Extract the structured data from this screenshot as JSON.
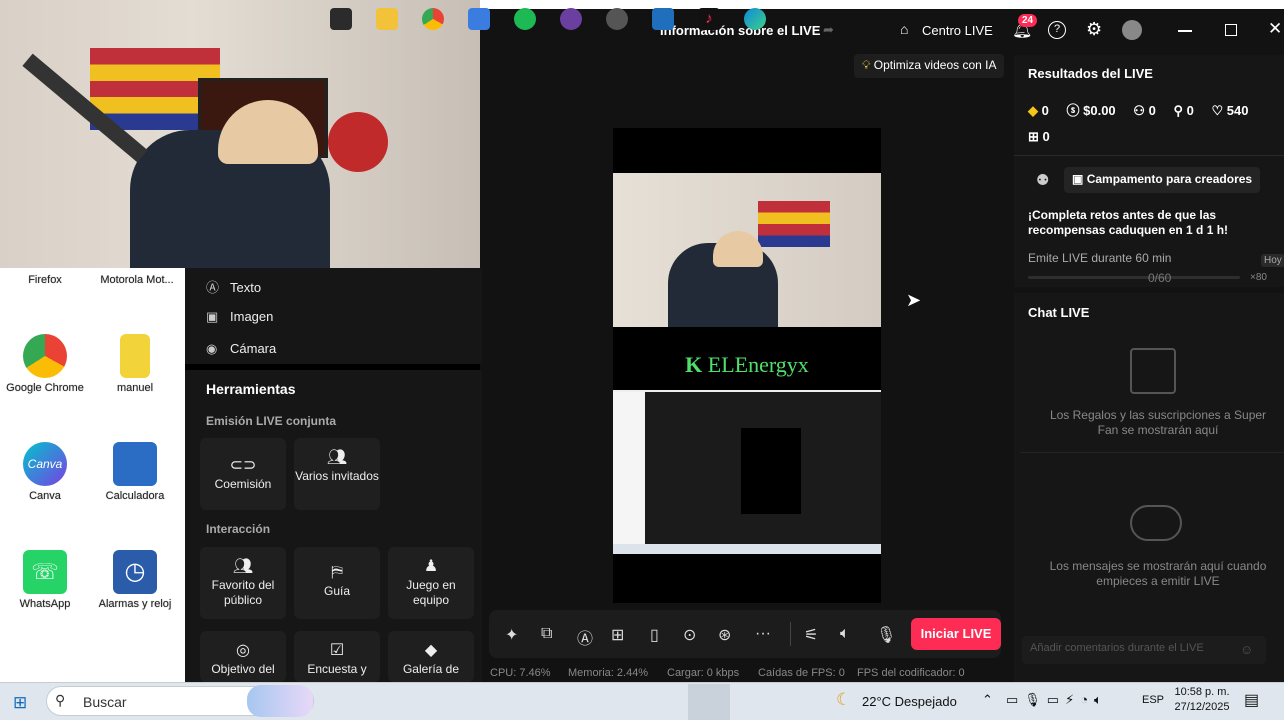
{
  "desktop": {
    "top_labels": [
      "Firefox",
      "Motorola Mot..."
    ],
    "icons": [
      {
        "label": "Google Chrome",
        "icon": "chrome-icon",
        "color": "#4285f4"
      },
      {
        "label": "manuel",
        "icon": "file-icon",
        "color": "#e0c020"
      },
      {
        "label": "Canva",
        "icon": "canva-icon",
        "color": "#7b3fe4"
      },
      {
        "label": "Calculadora",
        "icon": "calculator-icon",
        "color": "#2b6cc4"
      },
      {
        "label": "WhatsApp",
        "icon": "whatsapp-icon",
        "color": "#25d366"
      },
      {
        "label": "Alarmas y reloj",
        "icon": "clock-icon",
        "color": "#2a5caa"
      }
    ]
  },
  "header": {
    "live_info": "Información sobre el LIVE",
    "centro_live": "Centro LIVE",
    "notif_count": "24",
    "optimize": "Optimiza videos con IA"
  },
  "left_panel": {
    "media_items": [
      "Texto",
      "Imagen",
      "Cámara"
    ],
    "tools_title": "Herramientas",
    "joint_title": "Emisión LIVE conjunta",
    "joint_tools": [
      "Coemisión",
      "Varios invitados"
    ],
    "interaction_title": "Interacción",
    "interaction_tools": [
      "Favorito del público",
      "Guía",
      "Juego en equipo"
    ],
    "more_tools": [
      "Objetivo del",
      "Encuesta y",
      "Galería de"
    ]
  },
  "preview": {
    "brand": "ELEnergyx"
  },
  "controls": {
    "start_button": "Iniciar LIVE",
    "accent": "#fe2c55"
  },
  "status": {
    "cpu": "CPU: 7.46%",
    "memory": "Memoria: 2.44%",
    "load": "Cargar: 0 kbps",
    "fps_drops": "Caídas de FPS: 0",
    "encoder_fps": "FPS del codificador: 0"
  },
  "results": {
    "title": "Resultados del LIVE",
    "stats": [
      "0",
      "$0.00",
      "0",
      "0",
      "540"
    ],
    "gifts": "0",
    "bootcamp": "Campamento para creadores",
    "challenge": "¡Completa retos antes de que las recompensas caduquen en 1 d 1 h!",
    "task": "Emite LIVE durante 60 min",
    "progress": "0/60",
    "today": "Hoy",
    "multiplier": "×80"
  },
  "chat": {
    "title": "Chat LIVE",
    "gifts_msg": "Los Regalos y las suscripciones a Super Fan se mostrarán aquí",
    "messages_msg": "Los mensajes se mostrarán aquí cuando empieces a emitir LIVE",
    "input_placeholder": "Añadir comentarios durante el LIVE"
  },
  "taskbar": {
    "search": "Buscar",
    "weather": "22°C Despejado",
    "lang": "ESP",
    "time": "10:58 p. m.",
    "date": "27/12/2025"
  }
}
